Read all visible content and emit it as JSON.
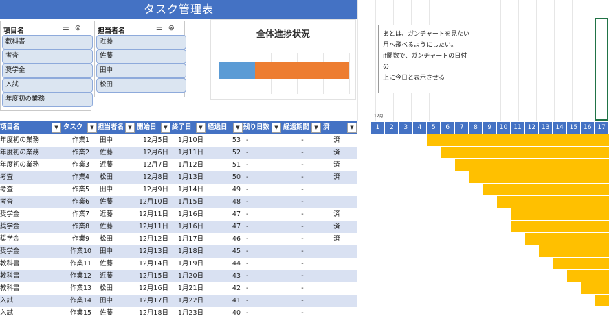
{
  "title": "タスク管理表",
  "slicer_items": {
    "header": "項目名",
    "items": [
      "教科書",
      "考査",
      "奨学金",
      "入試",
      "年度初の業務"
    ]
  },
  "slicer_owner": {
    "header": "担当者名",
    "items": [
      "近藤",
      "佐藤",
      "田中",
      "松田"
    ]
  },
  "slicer_icons": [
    "multi-select-icon",
    "clear-filter-icon"
  ],
  "chart": {
    "title": "全体進捗状況",
    "type": "bar",
    "series": [
      {
        "values": [
          28
        ],
        "color": "#5b9bd5"
      },
      {
        "values": [
          72
        ],
        "color": "#ed7d31"
      }
    ],
    "xlim": [
      0,
      100
    ]
  },
  "note": {
    "lines": [
      "あとは、ガンチャートを見たい",
      "月へ飛べるようにしたい。",
      "if関数で、ガンチャートの日付の",
      "上に今日と表示させる"
    ]
  },
  "month_label": "12月",
  "table": {
    "headers": [
      "項目名",
      "タスク",
      "担当者名",
      "開始日",
      "終了日",
      "経過日",
      "残り日数",
      "経過期間",
      "済"
    ],
    "rows": [
      [
        "年度初の業務",
        "作業1",
        "田中",
        "12月5日",
        "1月10日",
        "53",
        "-",
        "-",
        "済"
      ],
      [
        "年度初の業務",
        "作業2",
        "佐藤",
        "12月6日",
        "1月11日",
        "52",
        "-",
        "-",
        "済"
      ],
      [
        "年度初の業務",
        "作業3",
        "近藤",
        "12月7日",
        "1月12日",
        "51",
        "-",
        "-",
        "済"
      ],
      [
        "考査",
        "作業4",
        "松田",
        "12月8日",
        "1月13日",
        "50",
        "-",
        "-",
        "済"
      ],
      [
        "考査",
        "作業5",
        "田中",
        "12月9日",
        "1月14日",
        "49",
        "-",
        "-",
        ""
      ],
      [
        "考査",
        "作業6",
        "佐藤",
        "12月10日",
        "1月15日",
        "48",
        "-",
        "-",
        ""
      ],
      [
        "奨学金",
        "作業7",
        "近藤",
        "12月11日",
        "1月16日",
        "47",
        "-",
        "-",
        "済"
      ],
      [
        "奨学金",
        "作業8",
        "佐藤",
        "12月11日",
        "1月16日",
        "47",
        "-",
        "-",
        "済"
      ],
      [
        "奨学金",
        "作業9",
        "松田",
        "12月12日",
        "1月17日",
        "46",
        "-",
        "-",
        "済"
      ],
      [
        "奨学金",
        "作業10",
        "田中",
        "12月13日",
        "1月18日",
        "45",
        "-",
        "-",
        ""
      ],
      [
        "教科書",
        "作業11",
        "佐藤",
        "12月14日",
        "1月19日",
        "44",
        "-",
        "-",
        ""
      ],
      [
        "教科書",
        "作業12",
        "近藤",
        "12月15日",
        "1月20日",
        "43",
        "-",
        "-",
        ""
      ],
      [
        "教科書",
        "作業13",
        "松田",
        "12月16日",
        "1月21日",
        "42",
        "-",
        "-",
        ""
      ],
      [
        "入試",
        "作業14",
        "田中",
        "12月17日",
        "1月22日",
        "41",
        "-",
        "-",
        ""
      ],
      [
        "入試",
        "作業15",
        "佐藤",
        "12月18日",
        "1月23日",
        "40",
        "-",
        "-",
        ""
      ]
    ]
  },
  "gantt": {
    "days": [
      "1",
      "2",
      "3",
      "4",
      "5",
      "6",
      "7",
      "8",
      "9",
      "10",
      "11",
      "12",
      "13",
      "14",
      "15",
      "16",
      "17"
    ],
    "start_days": [
      5,
      6,
      7,
      8,
      9,
      10,
      11,
      11,
      12,
      13,
      14,
      15,
      16,
      17,
      18
    ],
    "bar_color": "#ffc000",
    "header_color": "#4472c4"
  }
}
